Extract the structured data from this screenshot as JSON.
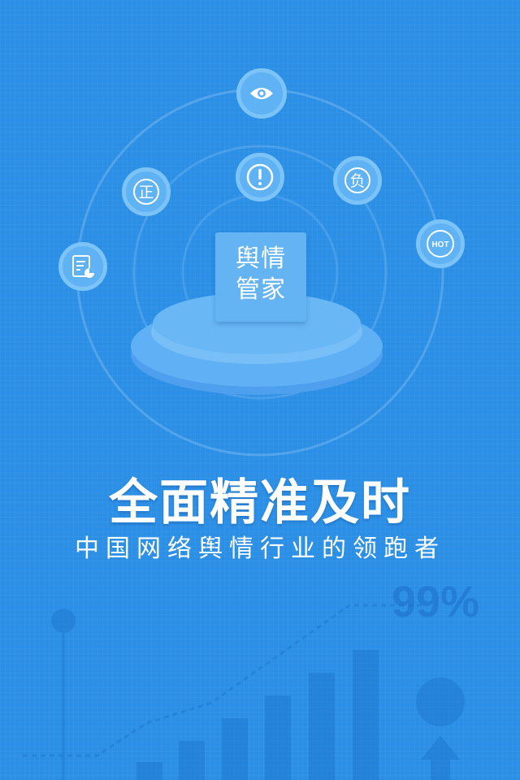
{
  "logo": {
    "line1": "舆情",
    "line2": "管家"
  },
  "headline": "全面精准及时",
  "subline": "中国网络舆情行业的领跑者",
  "decor": {
    "percent": "99%",
    "badge_small": "HOT",
    "icon_positive_char": "正",
    "icon_negative_char": "负"
  },
  "icons": [
    "eye-icon",
    "alert-icon",
    "positive-icon",
    "negative-icon",
    "hot-icon",
    "report-icon"
  ],
  "colors": {
    "background": "#2b8fe6",
    "badge": "#5fb3f5",
    "badge_ring": "#7cc3f8",
    "platform": "#5cabf3"
  }
}
